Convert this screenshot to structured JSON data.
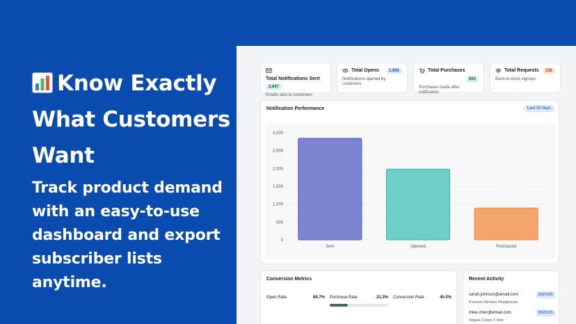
{
  "promo": {
    "title_line1": "Know Exactly",
    "title_line2": "What Customers",
    "title_line3": "Want",
    "subtitle_line1": "Track product demand",
    "subtitle_line2": "with an easy-to-use",
    "subtitle_line3": "dashboard and export",
    "subtitle_line4": "subscriber lists anytime.",
    "icon": "bar-chart-emoji"
  },
  "stats": [
    {
      "icon": "mail-icon",
      "label": "Total Notifications Sent",
      "badge": "2,847",
      "desc": "Emails sent to customers",
      "color": "#146b5c"
    },
    {
      "icon": "eye-icon",
      "label": "Total Opens",
      "badge": "1,983",
      "desc": "Notifications opened by customers",
      "color": "#1d4ed8"
    },
    {
      "icon": "cart-icon",
      "label": "Total Purchases",
      "badge": "892",
      "desc": "Purchases made after notification",
      "color": "#146b5c"
    },
    {
      "icon": "gear-icon",
      "label": "Total Requests",
      "badge": "156",
      "desc": "Back-in-stock signups",
      "color": "#c2410c"
    }
  ],
  "performance": {
    "title": "Notification Performance",
    "period": "Last 30 days"
  },
  "chart_data": {
    "type": "bar",
    "title": "",
    "categories": [
      "Sent",
      "Opened",
      "Purchased"
    ],
    "values": [
      2847,
      1983,
      892
    ],
    "colors": [
      "#7b84d0",
      "#6fcfc6",
      "#f4a66a"
    ],
    "strokes": [
      "#5a63b5",
      "#3fb5aa",
      "#e68a45"
    ],
    "ylim": [
      0,
      3000
    ],
    "yticks": [
      0,
      500,
      1000,
      1500,
      2000,
      2500,
      3000
    ],
    "ytick_labels": [
      "0",
      "500",
      "1,000",
      "1,500",
      "2,000",
      "2,500",
      "3,000"
    ],
    "grid": true,
    "xlabel": "",
    "ylabel": ""
  },
  "metrics": {
    "title": "Conversion Metrics",
    "open_rate_label": "Open Rate",
    "open_rate_value": "69.7%",
    "purchase_rate_label": "Purchase Rate",
    "purchase_rate_value": "31.3%",
    "purchase_rate_fraction": 0.313,
    "conversion_rate_label": "Conversion Rate",
    "conversion_rate_value": "45.0%"
  },
  "activity": {
    "title": "Recent Activity",
    "items": [
      {
        "email": "sarah.johnson@email.com",
        "product": "Premium Wireless Headphones",
        "date": "8/8/2025"
      },
      {
        "email": "mike.chen@email.com",
        "product": "Organic Cotton T-Shirt",
        "date": "8/8/2025"
      }
    ]
  }
}
